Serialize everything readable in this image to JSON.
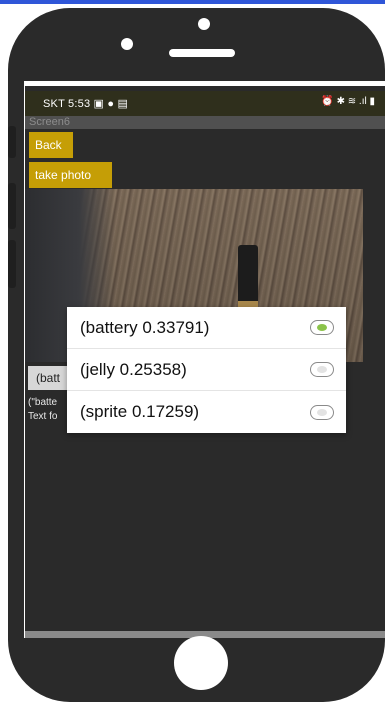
{
  "status_bar": {
    "carrier_time": "SKT  5:53",
    "left_icons": "▣ ● ▤",
    "right_icons": "⏰ ✱ ≋ .ıl ▮"
  },
  "app_title": "Screen6",
  "buttons": {
    "back": "Back",
    "take_photo": "take photo"
  },
  "result_button": "(batt",
  "result_text_lines": [
    "(\"batte",
    "Text fo"
  ],
  "dialog": {
    "options": [
      {
        "label": "(battery 0.33791)",
        "selected": true
      },
      {
        "label": "(jelly 0.25358)",
        "selected": false
      },
      {
        "label": "(sprite 0.17259)",
        "selected": false
      }
    ]
  },
  "colors": {
    "accent_gold": "#c59e06",
    "radio_selected": "#8bc34a",
    "top_bar": "#2f56d8"
  }
}
